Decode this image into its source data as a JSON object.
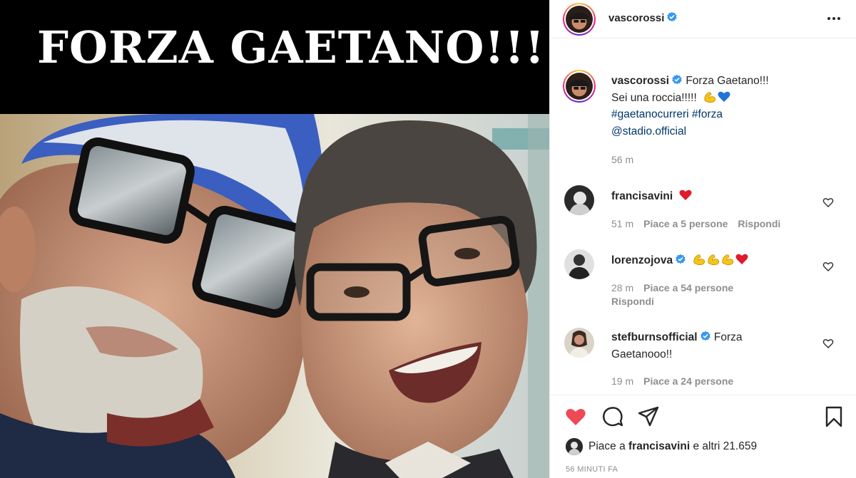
{
  "post": {
    "banner_text": "FORZA GAETANO!!!",
    "author": "vascorossi",
    "caption_text": "Forza Gaetano!!!",
    "caption_line2": "Sei una roccia!!!!!",
    "caption_emojis": [
      "flexed-biceps-icon",
      "blue-heart-icon"
    ],
    "hashtag1": "#gaetanocurreri",
    "hashtag2": "#forza",
    "mention": "@stadio.official",
    "caption_time": "56 m"
  },
  "comments": [
    {
      "username": "francisavini",
      "verified": false,
      "text": "",
      "emojis": [
        "red-heart-icon"
      ],
      "time": "51 m",
      "likes": "Piace a 5 persone",
      "reply": "Rispondi"
    },
    {
      "username": "lorenzojova",
      "verified": true,
      "text": "",
      "emojis": [
        "flexed-biceps-icon",
        "flexed-biceps-icon",
        "flexed-biceps-icon",
        "red-heart-icon"
      ],
      "time": "28 m",
      "likes": "Piace a 54 persone",
      "reply": "Rispondi"
    },
    {
      "username": "stefburnsofficial",
      "verified": true,
      "text": "Forza",
      "text_line2": "Gaetanooo!!",
      "time": "19 m",
      "likes": "Piace a 24 persone"
    }
  ],
  "likes_bar": {
    "prefix": "Piace a ",
    "liker": "francisavini",
    "suffix": " e altri 21.659"
  },
  "time_ago": "56 MINUTI FA",
  "colors": {
    "verified": "#3897f0",
    "liked_heart": "#ed4956",
    "hashtag": "#00376b",
    "muted": "#8e8e8e"
  }
}
